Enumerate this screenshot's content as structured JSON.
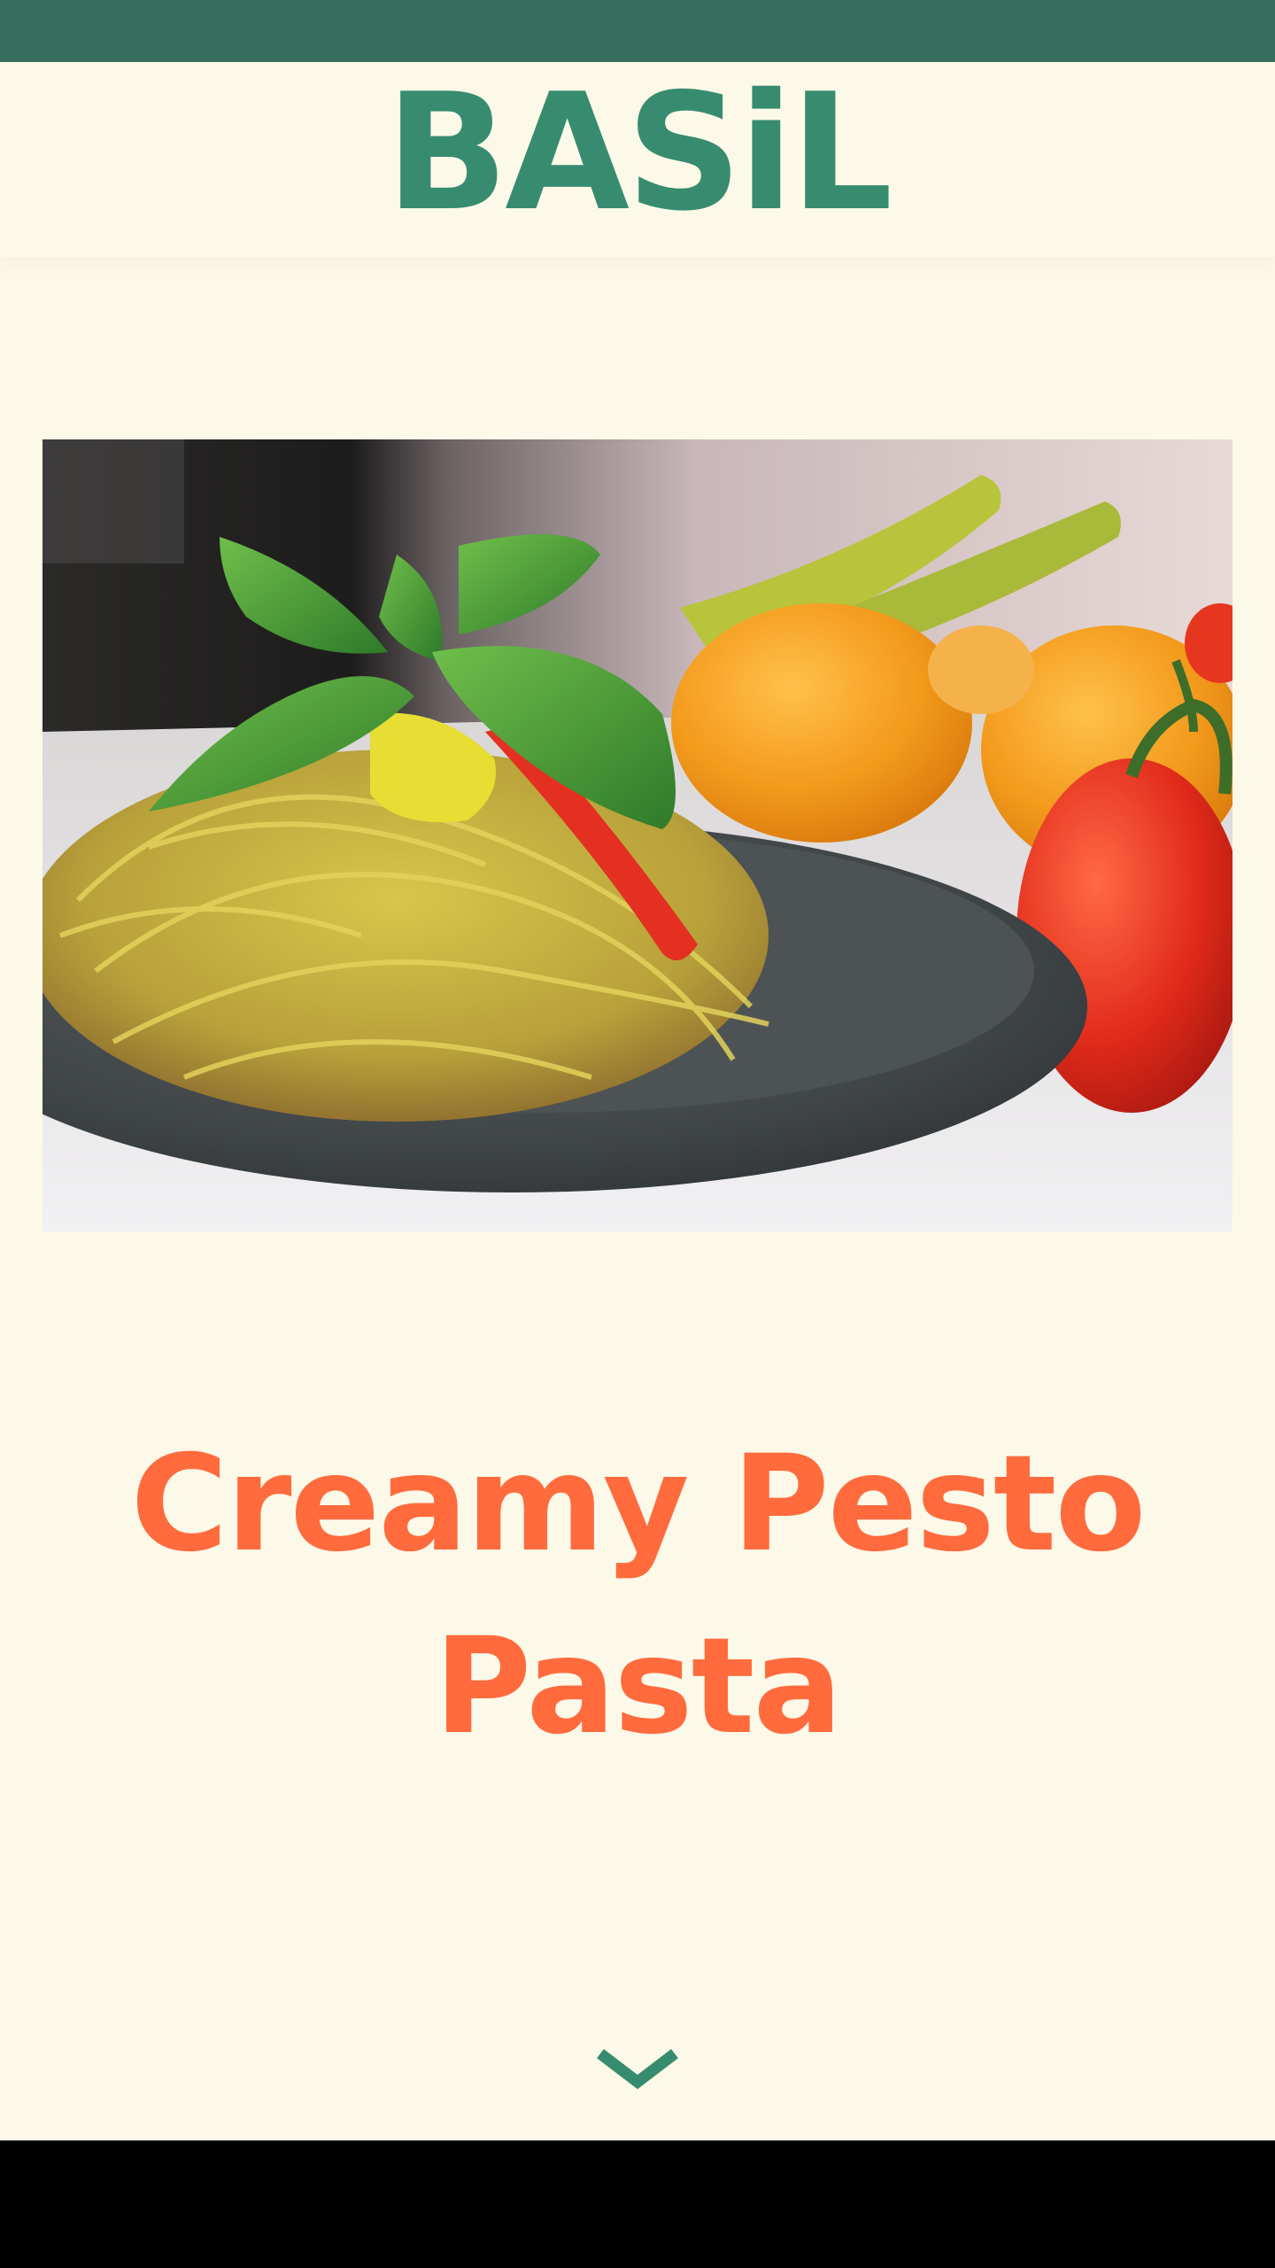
{
  "brand": {
    "name": "BASiL"
  },
  "hero": {
    "image_description": "spaghetti-with-basil-tomatoes-and-oranges"
  },
  "recipe": {
    "title": "Creamy Pesto Pasta"
  },
  "scroll": {
    "icon": "chevron-down-icon"
  },
  "colors": {
    "status_bar": "#366e5e",
    "background": "#fdf9e9",
    "brand": "#378c6f",
    "title": "#ff6b3d",
    "chevron": "#378c6f",
    "system_nav": "#000000"
  }
}
